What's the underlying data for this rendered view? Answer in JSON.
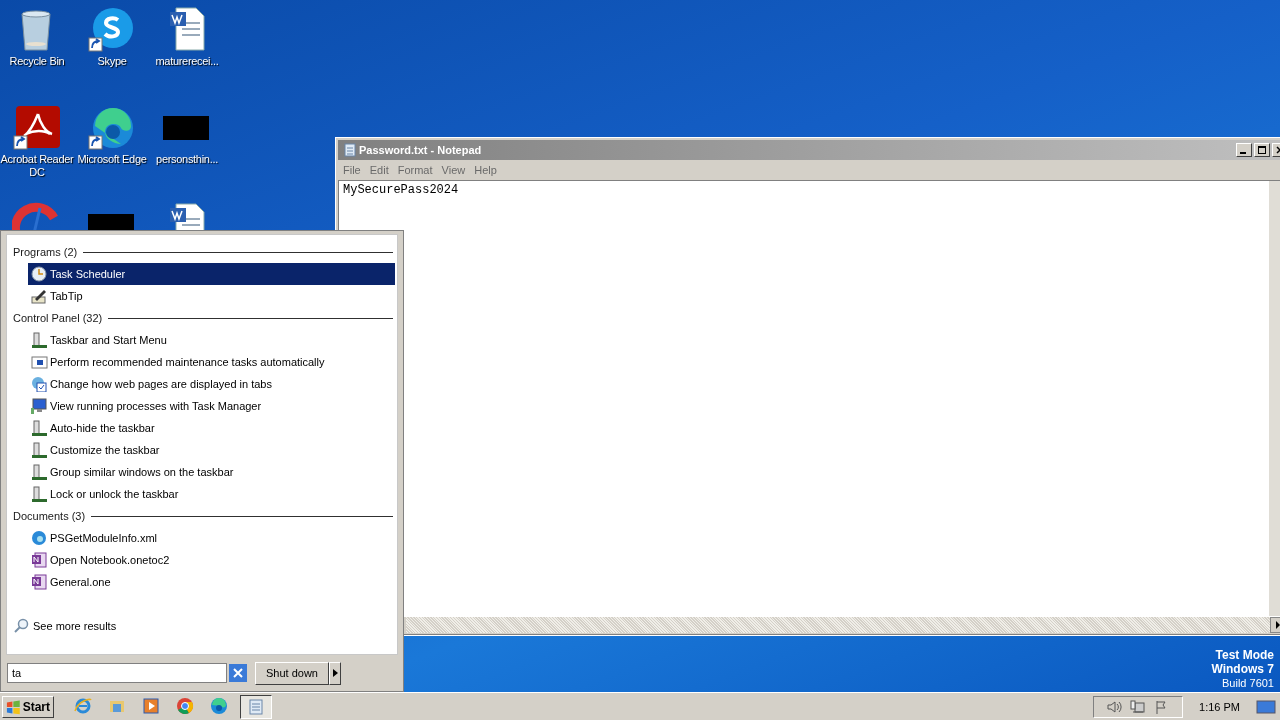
{
  "desktop": {
    "icons": [
      {
        "kind": "recycle",
        "label": "Recycle Bin",
        "shortcut": false
      },
      {
        "kind": "skype",
        "label": "Skype",
        "shortcut": true
      },
      {
        "kind": "word",
        "label": "maturerecei...",
        "shortcut": false
      },
      {
        "kind": "acrobat",
        "label": "Acrobat Reader DC",
        "shortcut": true
      },
      {
        "kind": "edge",
        "label": "Microsoft Edge",
        "shortcut": true
      },
      {
        "kind": "dark",
        "label": "personsthin...",
        "shortcut": false
      },
      {
        "kind": "ccleaner"
      },
      {
        "kind": "dark"
      },
      {
        "kind": "word"
      }
    ],
    "badge": [
      "Test Mode",
      "Windows 7",
      "Build 7601"
    ]
  },
  "notepad": {
    "title": "Password.txt - Notepad",
    "menu": [
      "File",
      "Edit",
      "Format",
      "View",
      "Help"
    ],
    "content": "MySecurePass2024"
  },
  "start_menu": {
    "groups": [
      {
        "heading": "Programs (2)",
        "items": [
          {
            "kind": "clock",
            "label": "Task Scheduler",
            "selected": true
          },
          {
            "kind": "pen",
            "label": "TabTip",
            "selected": false
          }
        ]
      },
      {
        "heading": "Control Panel (32)",
        "items": [
          {
            "kind": "panel",
            "label": "Taskbar and Start Menu",
            "selected": false
          },
          {
            "kind": "maint",
            "label": "Perform recommended maintenance tasks automatically",
            "selected": false
          },
          {
            "kind": "globe",
            "label": "Change how web pages are displayed in tabs",
            "selected": false
          },
          {
            "kind": "monitor",
            "label": "View running processes with Task Manager",
            "selected": false
          },
          {
            "kind": "panel",
            "label": "Auto-hide the taskbar",
            "selected": false
          },
          {
            "kind": "panel",
            "label": "Customize the taskbar",
            "selected": false
          },
          {
            "kind": "panel",
            "label": "Group similar windows on the taskbar",
            "selected": false
          },
          {
            "kind": "panel",
            "label": "Lock or unlock the taskbar",
            "selected": false
          }
        ]
      },
      {
        "heading": "Documents (3)",
        "items": [
          {
            "kind": "edge",
            "label": "PSGetModuleInfo.xml",
            "selected": false
          },
          {
            "kind": "onenote",
            "label": "Open Notebook.onetoc2",
            "selected": false
          },
          {
            "kind": "onenote",
            "label": "General.one",
            "selected": false
          }
        ]
      }
    ],
    "see_more": "See more results",
    "search": {
      "value": "ta"
    },
    "shutdown": "Shut down"
  },
  "taskbar": {
    "start": "Start",
    "apps": [
      {
        "kind": "ie",
        "active": false
      },
      {
        "kind": "folder",
        "active": false
      },
      {
        "kind": "media",
        "active": false
      },
      {
        "kind": "chrome",
        "active": false
      },
      {
        "kind": "edge",
        "active": false
      },
      {
        "kind": "notepad",
        "active": true
      }
    ],
    "time": "1:16 PM"
  }
}
